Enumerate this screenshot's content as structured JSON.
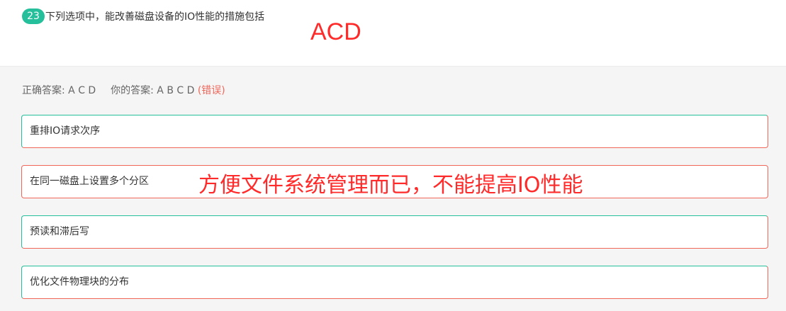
{
  "question": {
    "number": "23",
    "text": "下列选项中，能改善磁盘设备的IO性能的措施包括"
  },
  "annotations": {
    "answer": "ACD",
    "note": "方便文件系统管理而已，不能提高IO性能"
  },
  "result": {
    "correct_label": "正确答案:",
    "correct_value": "A C D",
    "yours_label": "你的答案:",
    "yours_value": "A B C D",
    "status": "(错误)"
  },
  "options": [
    {
      "text": "重排IO请求次序",
      "state": "mixed"
    },
    {
      "text": "在同一磁盘上设置多个分区",
      "state": "wrong"
    },
    {
      "text": "预读和滞后写",
      "state": "mixed"
    },
    {
      "text": "优化文件物理块的分布",
      "state": "mixed"
    }
  ],
  "colors": {
    "accent": "#25bf9b",
    "error": "#f0675a",
    "annotation": "#ff2a2a"
  }
}
